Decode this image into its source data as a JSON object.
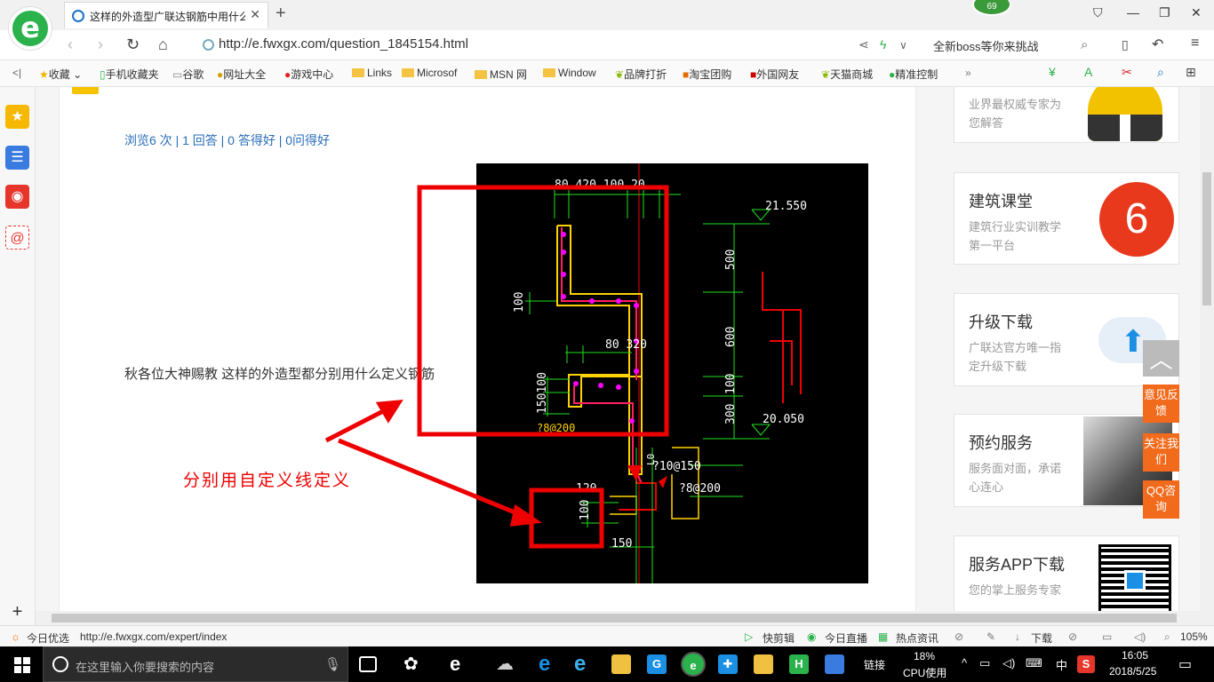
{
  "browser": {
    "tab_title": "这样的外造型广联达钢筋中用什么",
    "badge_count": "69",
    "url": "http://e.fwxgx.com/question_1845154.html",
    "search_placeholder": "全新boss等你来挑战"
  },
  "bookmarks": [
    "收藏",
    "手机收藏夹",
    "谷歌",
    "网址大全",
    "游戏中心",
    "Links",
    "Microsof",
    "MSN 网",
    "Window",
    "品牌打折",
    "淘宝团购",
    "外国网友",
    "天猫商城",
    "精准控制"
  ],
  "question": {
    "stats": "浏览6 次 | 1 回答 | 0 答得好 | 0问得好",
    "text": "秋各位大神赐教 这样的外造型都分别用什么定义钢筋",
    "annotation": "分别用自定义线定义"
  },
  "cad": {
    "dims_top": "80  420  100 20",
    "elev_top": "21.550",
    "elev_bottom": "20.050",
    "dim_500": "500",
    "dim_600": "600",
    "dim_100": "100",
    "dim_300": "300",
    "dim_left_100": "100",
    "dim_80_320": "80   320",
    "dim_150_100": "150100",
    "rebar_a": "?8@200",
    "rebar_b": "?10@150",
    "rebar_c": "?8@200",
    "dim_small_100": "100",
    "dim_150": "150",
    "dim_120": "120",
    "mark_l0": "L0"
  },
  "sidebar_cards": [
    {
      "title": "",
      "desc": "业界最权威专家为您解答"
    },
    {
      "title": "建筑课堂",
      "desc": "建筑行业实训教学第一平台"
    },
    {
      "title": "升级下载",
      "desc": "广联达官方唯一指定升级下载"
    },
    {
      "title": "预约服务",
      "desc": "服务面对面，承诺心连心"
    },
    {
      "title": "服务APP下载",
      "desc": "您的掌上服务专家"
    }
  ],
  "float_buttons": [
    "意见反馈",
    "关注我们",
    "QQ咨询"
  ],
  "statusbar": {
    "today": "今日优选",
    "status_url": "http://e.fwxgx.com/expert/index",
    "quick_clip": "快剪辑",
    "live": "今日直播",
    "news": "热点资讯",
    "download": "下载",
    "zoom": "105%"
  },
  "taskbar": {
    "search_placeholder": "在这里输入你要搜索的内容",
    "link_label": "链接",
    "cpu_percent": "18%",
    "cpu_label": "CPU使用",
    "ime": "中",
    "time": "16:05",
    "date": "2018/5/25"
  }
}
